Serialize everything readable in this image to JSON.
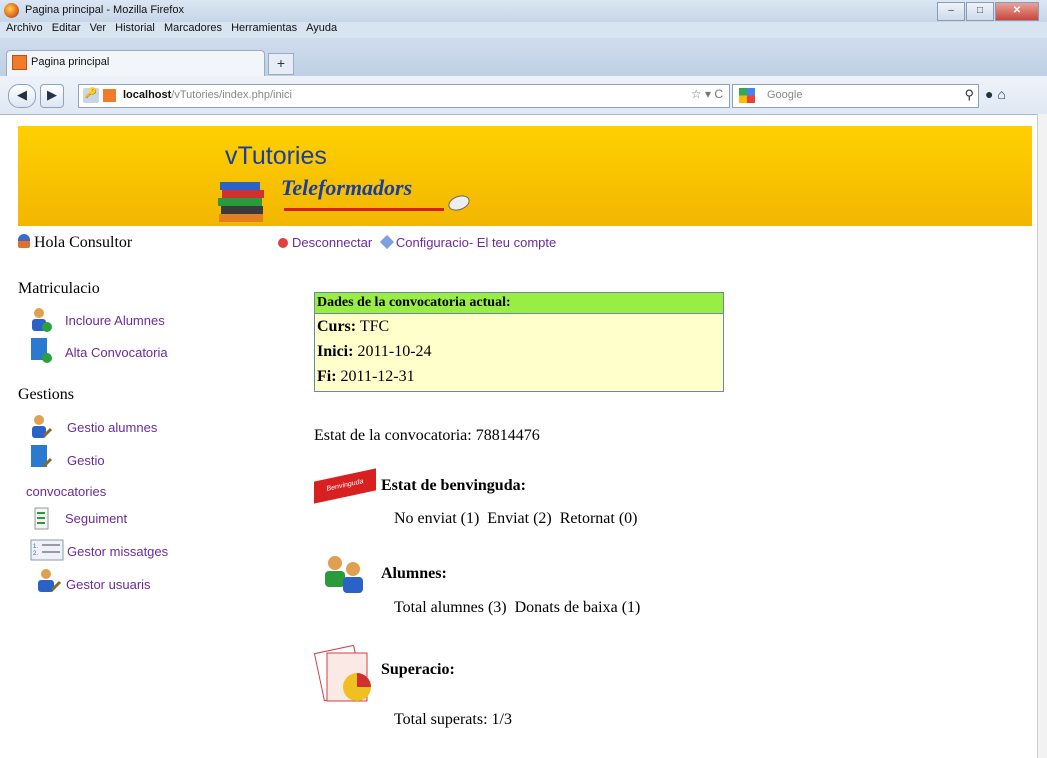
{
  "window": {
    "title": "Pagina principal - Mozilla Firefox"
  },
  "menubar": {
    "items": [
      "Archivo",
      "Editar",
      "Ver",
      "Historial",
      "Marcadores",
      "Herramientas",
      "Ayuda"
    ]
  },
  "tabs": [
    {
      "label": "Pagina principal"
    }
  ],
  "newtab_label": "+",
  "urlbar": {
    "host": "localhost",
    "path": "/vTutories/index.php/inici"
  },
  "search": {
    "placeholder": "Google"
  },
  "banner": {
    "title": "vTutories",
    "subtitle": "Teleformadors"
  },
  "header": {
    "greeting": "Hola Consultor",
    "disconnect": "Desconnectar",
    "config": "Configuracio- El teu compte"
  },
  "sidebar": {
    "sections": [
      {
        "title": "Matriculacio",
        "items": [
          "Incloure Alumnes",
          "Alta Convocatoria"
        ]
      },
      {
        "title": "Gestions",
        "items": [
          "Gestio alumnes",
          "Gestio",
          "convocatories",
          "Seguiment",
          "Gestor missatges",
          "Gestor usuaris"
        ]
      }
    ]
  },
  "convocatoria": {
    "header": "Dades de la convocatoria actual:",
    "curs_label": "Curs:",
    "curs": "TFC",
    "inici_label": "Inici:",
    "inici": "2011-10-24",
    "fi_label": "Fi:",
    "fi": "2011-12-31"
  },
  "estat": "Estat de la convocatoria: 78814476",
  "benvinguda": {
    "badge": "Benvinguda",
    "title": "Estat de benvinguda:",
    "detail": "No enviat (1)  Enviat (2)  Retornat (0)"
  },
  "alumnes": {
    "title": "Alumnes:",
    "detail": "Total alumnes (3)  Donats de baixa (1)"
  },
  "superacio": {
    "title": "Superacio:",
    "detail": "Total superats: 1/3"
  },
  "colors": {
    "banner": "#ffd000",
    "link": "#6a2aa0",
    "box_header": "#99ee44",
    "box_bg": "#ffffcc"
  }
}
